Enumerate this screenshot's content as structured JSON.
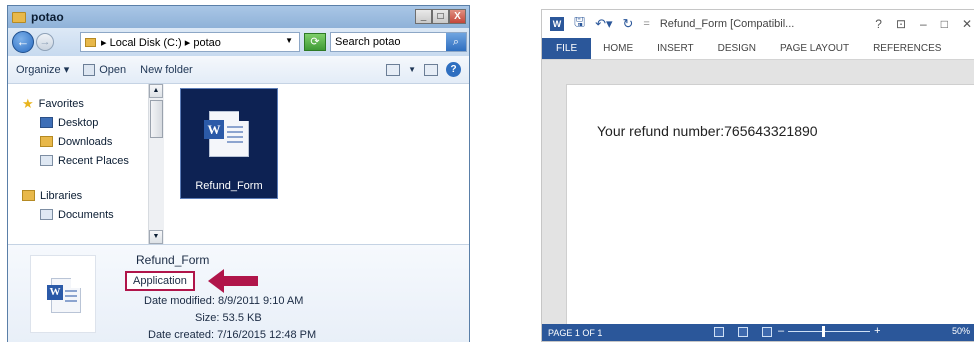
{
  "explorer": {
    "title": "potao",
    "controls": {
      "minimize": "_",
      "maximize": "□",
      "close": "X"
    },
    "address": {
      "path": "▸ Local Disk (C:) ▸ potao",
      "search_placeholder": "Search potao"
    },
    "toolbar": {
      "organize": "Organize ▾",
      "open": "Open",
      "new_folder": "New folder"
    },
    "nav": {
      "favorites": "Favorites",
      "desktop": "Desktop",
      "downloads": "Downloads",
      "recent": "Recent Places",
      "libraries": "Libraries",
      "documents": "Documents"
    },
    "file": {
      "name": "Refund_Form"
    },
    "details": {
      "name": "Refund_Form",
      "type": "Application",
      "modified_label": "Date modified:",
      "modified_value": "8/9/2011 9:10 AM",
      "size_label": "Size:",
      "size_value": "53.5 KB",
      "created_label": "Date created:",
      "created_value": "7/16/2015 12:48 PM"
    }
  },
  "word": {
    "title": "Refund_Form [Compatibil...",
    "controls": {
      "help": "?",
      "restore": "⊡",
      "minimize": "–",
      "maximize": "□",
      "close": "✕"
    },
    "tabs": [
      "FILE",
      "HOME",
      "INSERT",
      "DESIGN",
      "PAGE LAYOUT",
      "REFERENCES"
    ],
    "document_text": "Your refund number:765643321890",
    "status": {
      "page": "PAGE 1 OF 1",
      "zoom": "50%"
    }
  },
  "colors": {
    "arrow": "#b0154a",
    "word_blue": "#2b579a",
    "explorer_blue": "#8fb2d8"
  }
}
